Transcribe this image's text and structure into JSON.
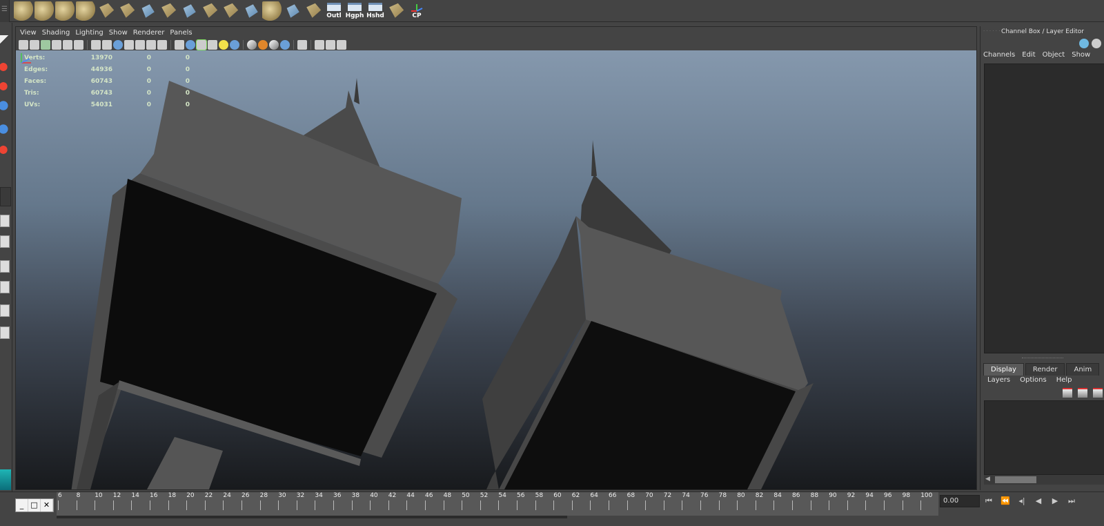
{
  "shelf": {
    "text_buttons": [
      {
        "label": "Outl",
        "icon": "outliner-icon"
      },
      {
        "label": "Hgph",
        "icon": "hypergraph-icon"
      },
      {
        "label": "Hshd",
        "icon": "hypershade-icon"
      }
    ],
    "cp_label": "CP"
  },
  "panel": {
    "menu": [
      "View",
      "Shading",
      "Lighting",
      "Show",
      "Renderer",
      "Panels"
    ]
  },
  "hud": {
    "rows": [
      {
        "label": "Verts:",
        "value": "13970",
        "sel": "0",
        "comp": "0"
      },
      {
        "label": "Edges:",
        "value": "44936",
        "sel": "0",
        "comp": "0"
      },
      {
        "label": "Faces:",
        "value": "60743",
        "sel": "0",
        "comp": "0"
      },
      {
        "label": "Tris:",
        "value": "60743",
        "sel": "0",
        "comp": "0"
      },
      {
        "label": "UVs:",
        "value": "54031",
        "sel": "0",
        "comp": "0"
      }
    ]
  },
  "channel_box": {
    "title": "Channel Box / Layer Editor",
    "menu": [
      "Channels",
      "Edit",
      "Object",
      "Show"
    ]
  },
  "layer_editor": {
    "tabs": [
      "Display",
      "Render",
      "Anim"
    ],
    "active_tab": "Display",
    "menu": [
      "Layers",
      "Options",
      "Help"
    ]
  },
  "timeslider": {
    "ticks": [
      "6",
      "8",
      "10",
      "12",
      "14",
      "16",
      "18",
      "20",
      "22",
      "24",
      "26",
      "28",
      "30",
      "32",
      "34",
      "36",
      "38",
      "40",
      "42",
      "44",
      "46",
      "48",
      "50",
      "52",
      "54",
      "56",
      "58",
      "60",
      "62",
      "64",
      "66",
      "68",
      "70",
      "72",
      "74",
      "76",
      "78",
      "80",
      "82",
      "84",
      "86",
      "88",
      "90",
      "92",
      "94",
      "96",
      "98",
      "100"
    ],
    "current_time": "0.00"
  },
  "mini_window": {
    "min": "_",
    "max": "□",
    "close": "✕"
  }
}
